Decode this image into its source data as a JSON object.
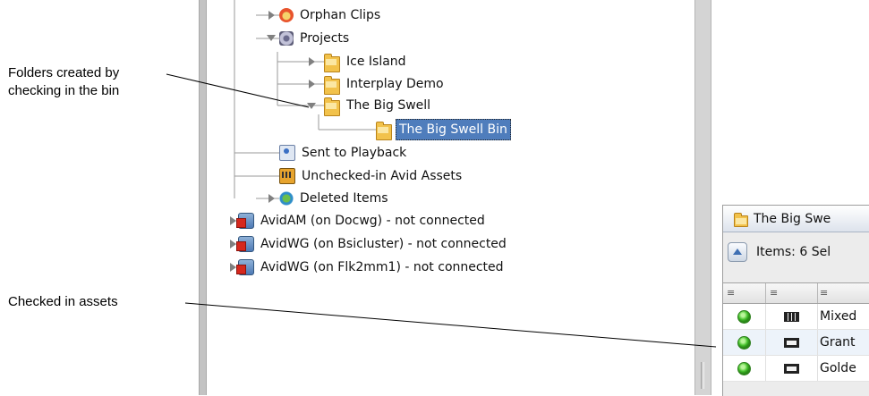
{
  "callouts": {
    "folders": "Folders created by checking in the bin",
    "checked": "Checked in assets"
  },
  "tree": {
    "items": [
      {
        "label": "Orphan Clips",
        "icon": "orphan-clips-icon"
      },
      {
        "label": "Projects",
        "icon": "projects-icon"
      },
      {
        "label": "Ice Island",
        "icon": "folder-icon"
      },
      {
        "label": "Interplay Demo",
        "icon": "folder-icon"
      },
      {
        "label": "The Big Swell",
        "icon": "folder-icon"
      },
      {
        "label": "The Big Swell Bin",
        "icon": "folder-icon",
        "selected": true
      },
      {
        "label": "Sent to Playback",
        "icon": "playback-icon"
      },
      {
        "label": "Unchecked-in Avid Assets",
        "icon": "unchecked-assets-icon"
      },
      {
        "label": "Deleted Items",
        "icon": "recycle-icon"
      },
      {
        "label": "AvidAM (on Docwg)  - not connected",
        "icon": "database-disconnected-icon"
      },
      {
        "label": "AvidWG (on Bsicluster)  - not connected",
        "icon": "database-disconnected-icon"
      },
      {
        "label": "AvidWG (on Flk2mm1)  - not connected",
        "icon": "database-disconnected-icon"
      }
    ]
  },
  "bin_panel": {
    "title": "The Big Swe",
    "items_text": "Items: 6 Sel",
    "columns": [
      "≡",
      "≡",
      "≡"
    ],
    "rows": [
      {
        "status": "green",
        "type": "sequence-icon",
        "name": "Mixed"
      },
      {
        "status": "green",
        "type": "clip-icon",
        "name": "Grant"
      },
      {
        "status": "green",
        "type": "clip-icon",
        "name": "Golde"
      }
    ]
  }
}
